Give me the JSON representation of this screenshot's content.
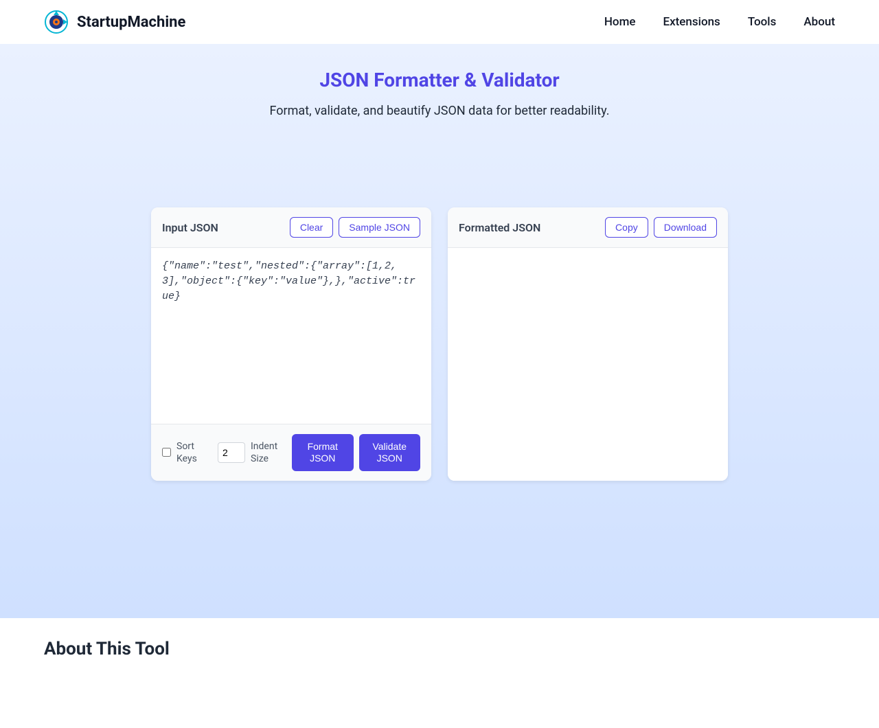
{
  "brand": {
    "name": "StartupMachine"
  },
  "nav": {
    "items": [
      "Home",
      "Extensions",
      "Tools",
      "About"
    ]
  },
  "hero": {
    "title": "JSON Formatter & Validator",
    "subtitle": "Format, validate, and beautify JSON data for better readability."
  },
  "input_panel": {
    "title": "Input JSON",
    "clear_label": "Clear",
    "sample_label": "Sample JSON",
    "value": "{\"name\":\"test\",\"nested\":{\"array\":[1,2,3],\"object\":{\"key\":\"value\"},},\"active\":true}",
    "sort_keys_label": "Sort Keys",
    "sort_keys_checked": false,
    "indent_value": "2",
    "indent_label": "Indent Size",
    "format_label": "Format JSON",
    "validate_label": "Validate JSON"
  },
  "output_panel": {
    "title": "Formatted JSON",
    "copy_label": "Copy",
    "download_label": "Download",
    "value": ""
  },
  "about": {
    "heading": "About This Tool"
  }
}
